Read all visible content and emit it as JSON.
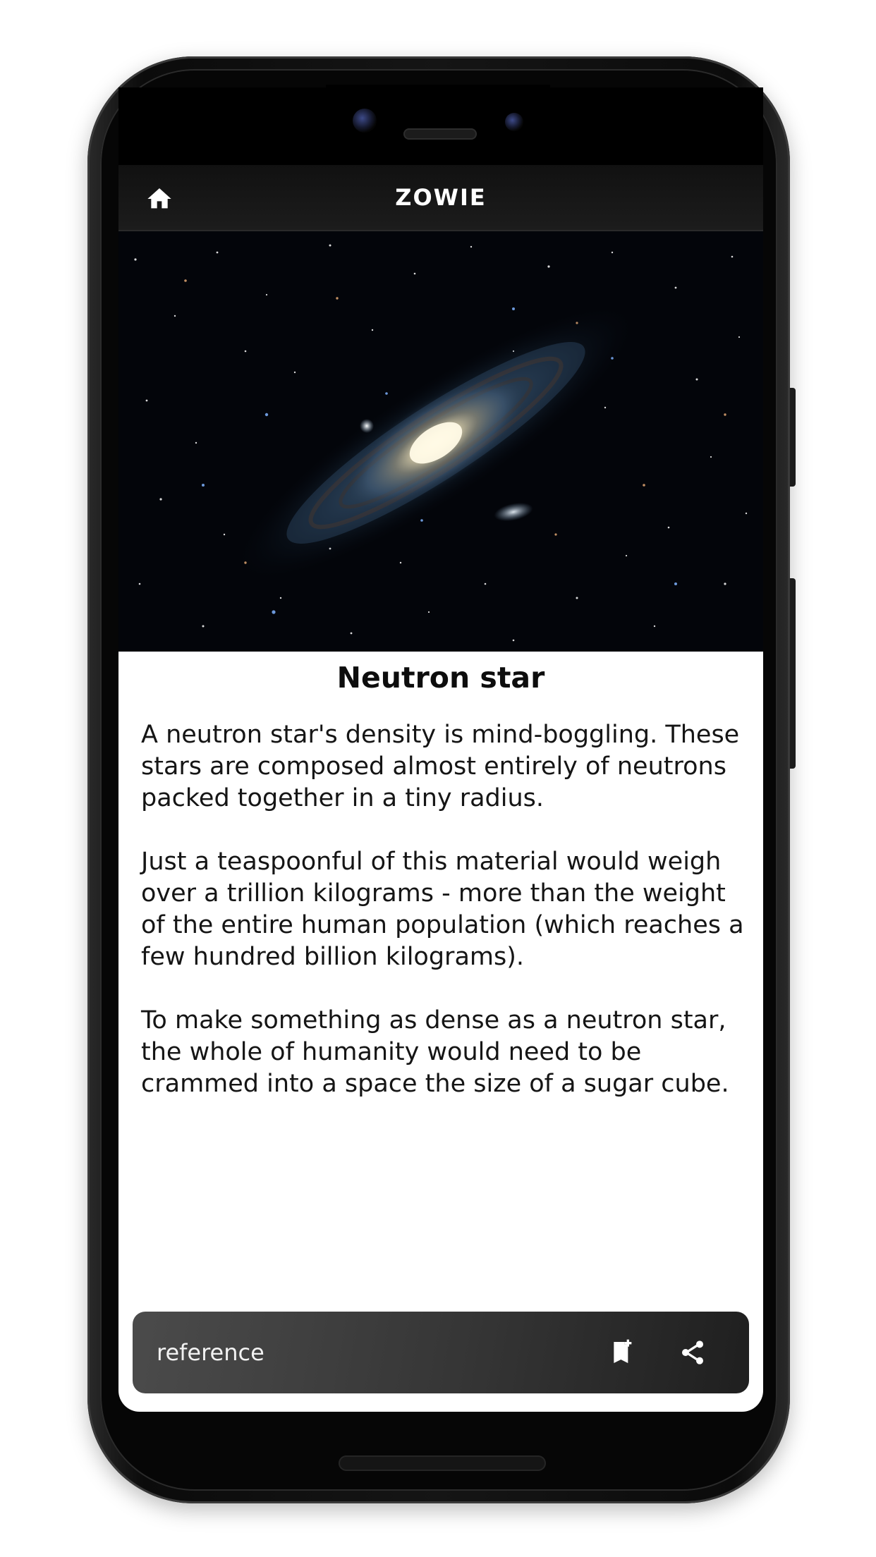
{
  "app_bar": {
    "title": "ZOWIE",
    "home_icon": "home-icon"
  },
  "hero": {
    "image": "andromeda-galaxy-photo"
  },
  "article": {
    "title": "Neutron star",
    "paragraphs": [
      "A neutron star's density is mind-boggling. These stars are composed almost entirely of neutrons packed together in a tiny radius.",
      "Just a teaspoonful of this material would weigh over a trillion kilograms - more than the weight of the entire human population (which reaches a few hundred billion kilograms).",
      "To make something as dense as a neutron star, the whole of humanity would need to be crammed into a space the size of a sugar cube."
    ]
  },
  "bottom_bar": {
    "reference_label": "reference",
    "bookmark_icon": "bookmark-add-icon",
    "share_icon": "share-icon"
  },
  "colors": {
    "app_bar_bg": "#161616",
    "bottom_bar_bg": "#3a3a3a",
    "text": "#151515"
  }
}
